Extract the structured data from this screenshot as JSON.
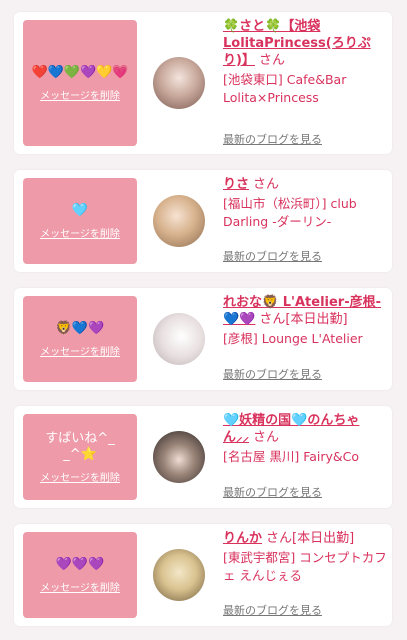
{
  "delete_label": "メッセージを削除",
  "blog_label": "最新のブログを見る",
  "san_label": "さん",
  "cards": [
    {
      "message": "❤️💙💚💜💛💗",
      "name": "🍀さと🍀【池袋LolitaPrincess(ろりぷり)】",
      "status": "",
      "shop": "[池袋東口] Cafe&Bar Lolita×Princess"
    },
    {
      "message": "🩵",
      "name": "りさ",
      "status": "",
      "shop": "[福山市（松浜町）] club Darling -ダーリン-"
    },
    {
      "message": "🦁💙💜",
      "name": "れおな🦁 L'Atelier-彦根-💙💜",
      "status": "[本日出勤]",
      "shop": "[彦根] Lounge L'Atelier"
    },
    {
      "message": "すばいね^_ _^⭐️",
      "name": "🩵妖精の国🩵のんちゃん⸝⸝",
      "status": "",
      "shop": "[名古屋 黒川] Fairy&Co"
    },
    {
      "message": "💜💜💜",
      "name": "りんか",
      "status": "[本日出勤]",
      "shop": "[東武宇都宮] コンセプトカフェ えんじぇる"
    }
  ],
  "colors": {
    "accent": "#d8325d",
    "message_bg": "#ee9aa8",
    "page_bg": "#f6f1f2"
  }
}
